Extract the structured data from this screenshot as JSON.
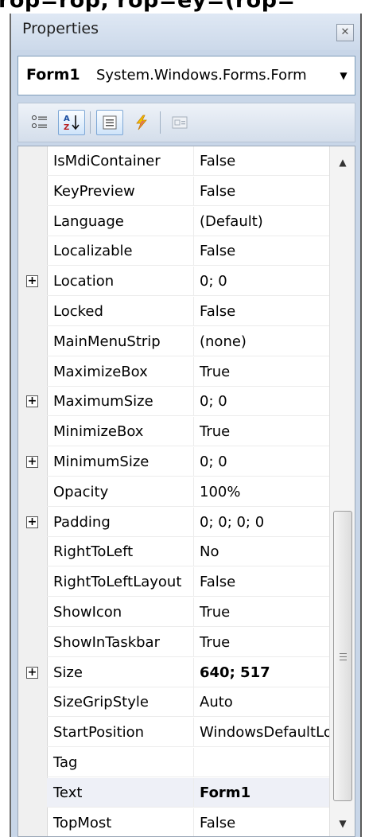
{
  "top_text": "rop=rop, rop=ey=(rop=",
  "panel": {
    "title": "Properties",
    "close_glyph": "✕"
  },
  "object_selector": {
    "name": "Form1",
    "type": "System.Windows.Forms.Form",
    "dropdown_glyph": "▼"
  },
  "toolbar": {
    "buttons": [
      {
        "icon": "categorized-icon",
        "active": false
      },
      {
        "icon": "alphabetical-icon",
        "active": true
      },
      {
        "icon": "properties-icon",
        "active": true
      },
      {
        "icon": "events-icon",
        "active": false
      },
      {
        "icon": "property-pages-icon",
        "active": false
      }
    ]
  },
  "grid": {
    "rows": [
      {
        "name": "IsMdiContainer",
        "value": "False",
        "expandable": false
      },
      {
        "name": "KeyPreview",
        "value": "False",
        "expandable": false
      },
      {
        "name": "Language",
        "value": "(Default)",
        "expandable": false
      },
      {
        "name": "Localizable",
        "value": "False",
        "expandable": false
      },
      {
        "name": "Location",
        "value": "0; 0",
        "expandable": true
      },
      {
        "name": "Locked",
        "value": "False",
        "expandable": false
      },
      {
        "name": "MainMenuStrip",
        "value": "(none)",
        "expandable": false
      },
      {
        "name": "MaximizeBox",
        "value": "True",
        "expandable": false
      },
      {
        "name": "MaximumSize",
        "value": "0; 0",
        "expandable": true
      },
      {
        "name": "MinimizeBox",
        "value": "True",
        "expandable": false
      },
      {
        "name": "MinimumSize",
        "value": "0; 0",
        "expandable": true
      },
      {
        "name": "Opacity",
        "value": "100%",
        "expandable": false
      },
      {
        "name": "Padding",
        "value": "0; 0; 0; 0",
        "expandable": true
      },
      {
        "name": "RightToLeft",
        "value": "No",
        "expandable": false
      },
      {
        "name": "RightToLeftLayout",
        "value": "False",
        "expandable": false
      },
      {
        "name": "ShowIcon",
        "value": "True",
        "expandable": false
      },
      {
        "name": "ShowInTaskbar",
        "value": "True",
        "expandable": false
      },
      {
        "name": "Size",
        "value": "640; 517",
        "expandable": true,
        "bold": true
      },
      {
        "name": "SizeGripStyle",
        "value": "Auto",
        "expandable": false
      },
      {
        "name": "StartPosition",
        "value": "WindowsDefaultLocation",
        "expandable": false
      },
      {
        "name": "Tag",
        "value": "",
        "expandable": false
      },
      {
        "name": "Text",
        "value": "Form1",
        "expandable": false,
        "bold": true,
        "selected": true
      },
      {
        "name": "TopMost",
        "value": "False",
        "expandable": false
      }
    ],
    "expander_glyph": "+"
  },
  "scrollbar": {
    "up_glyph": "▲",
    "down_glyph": "▼"
  }
}
